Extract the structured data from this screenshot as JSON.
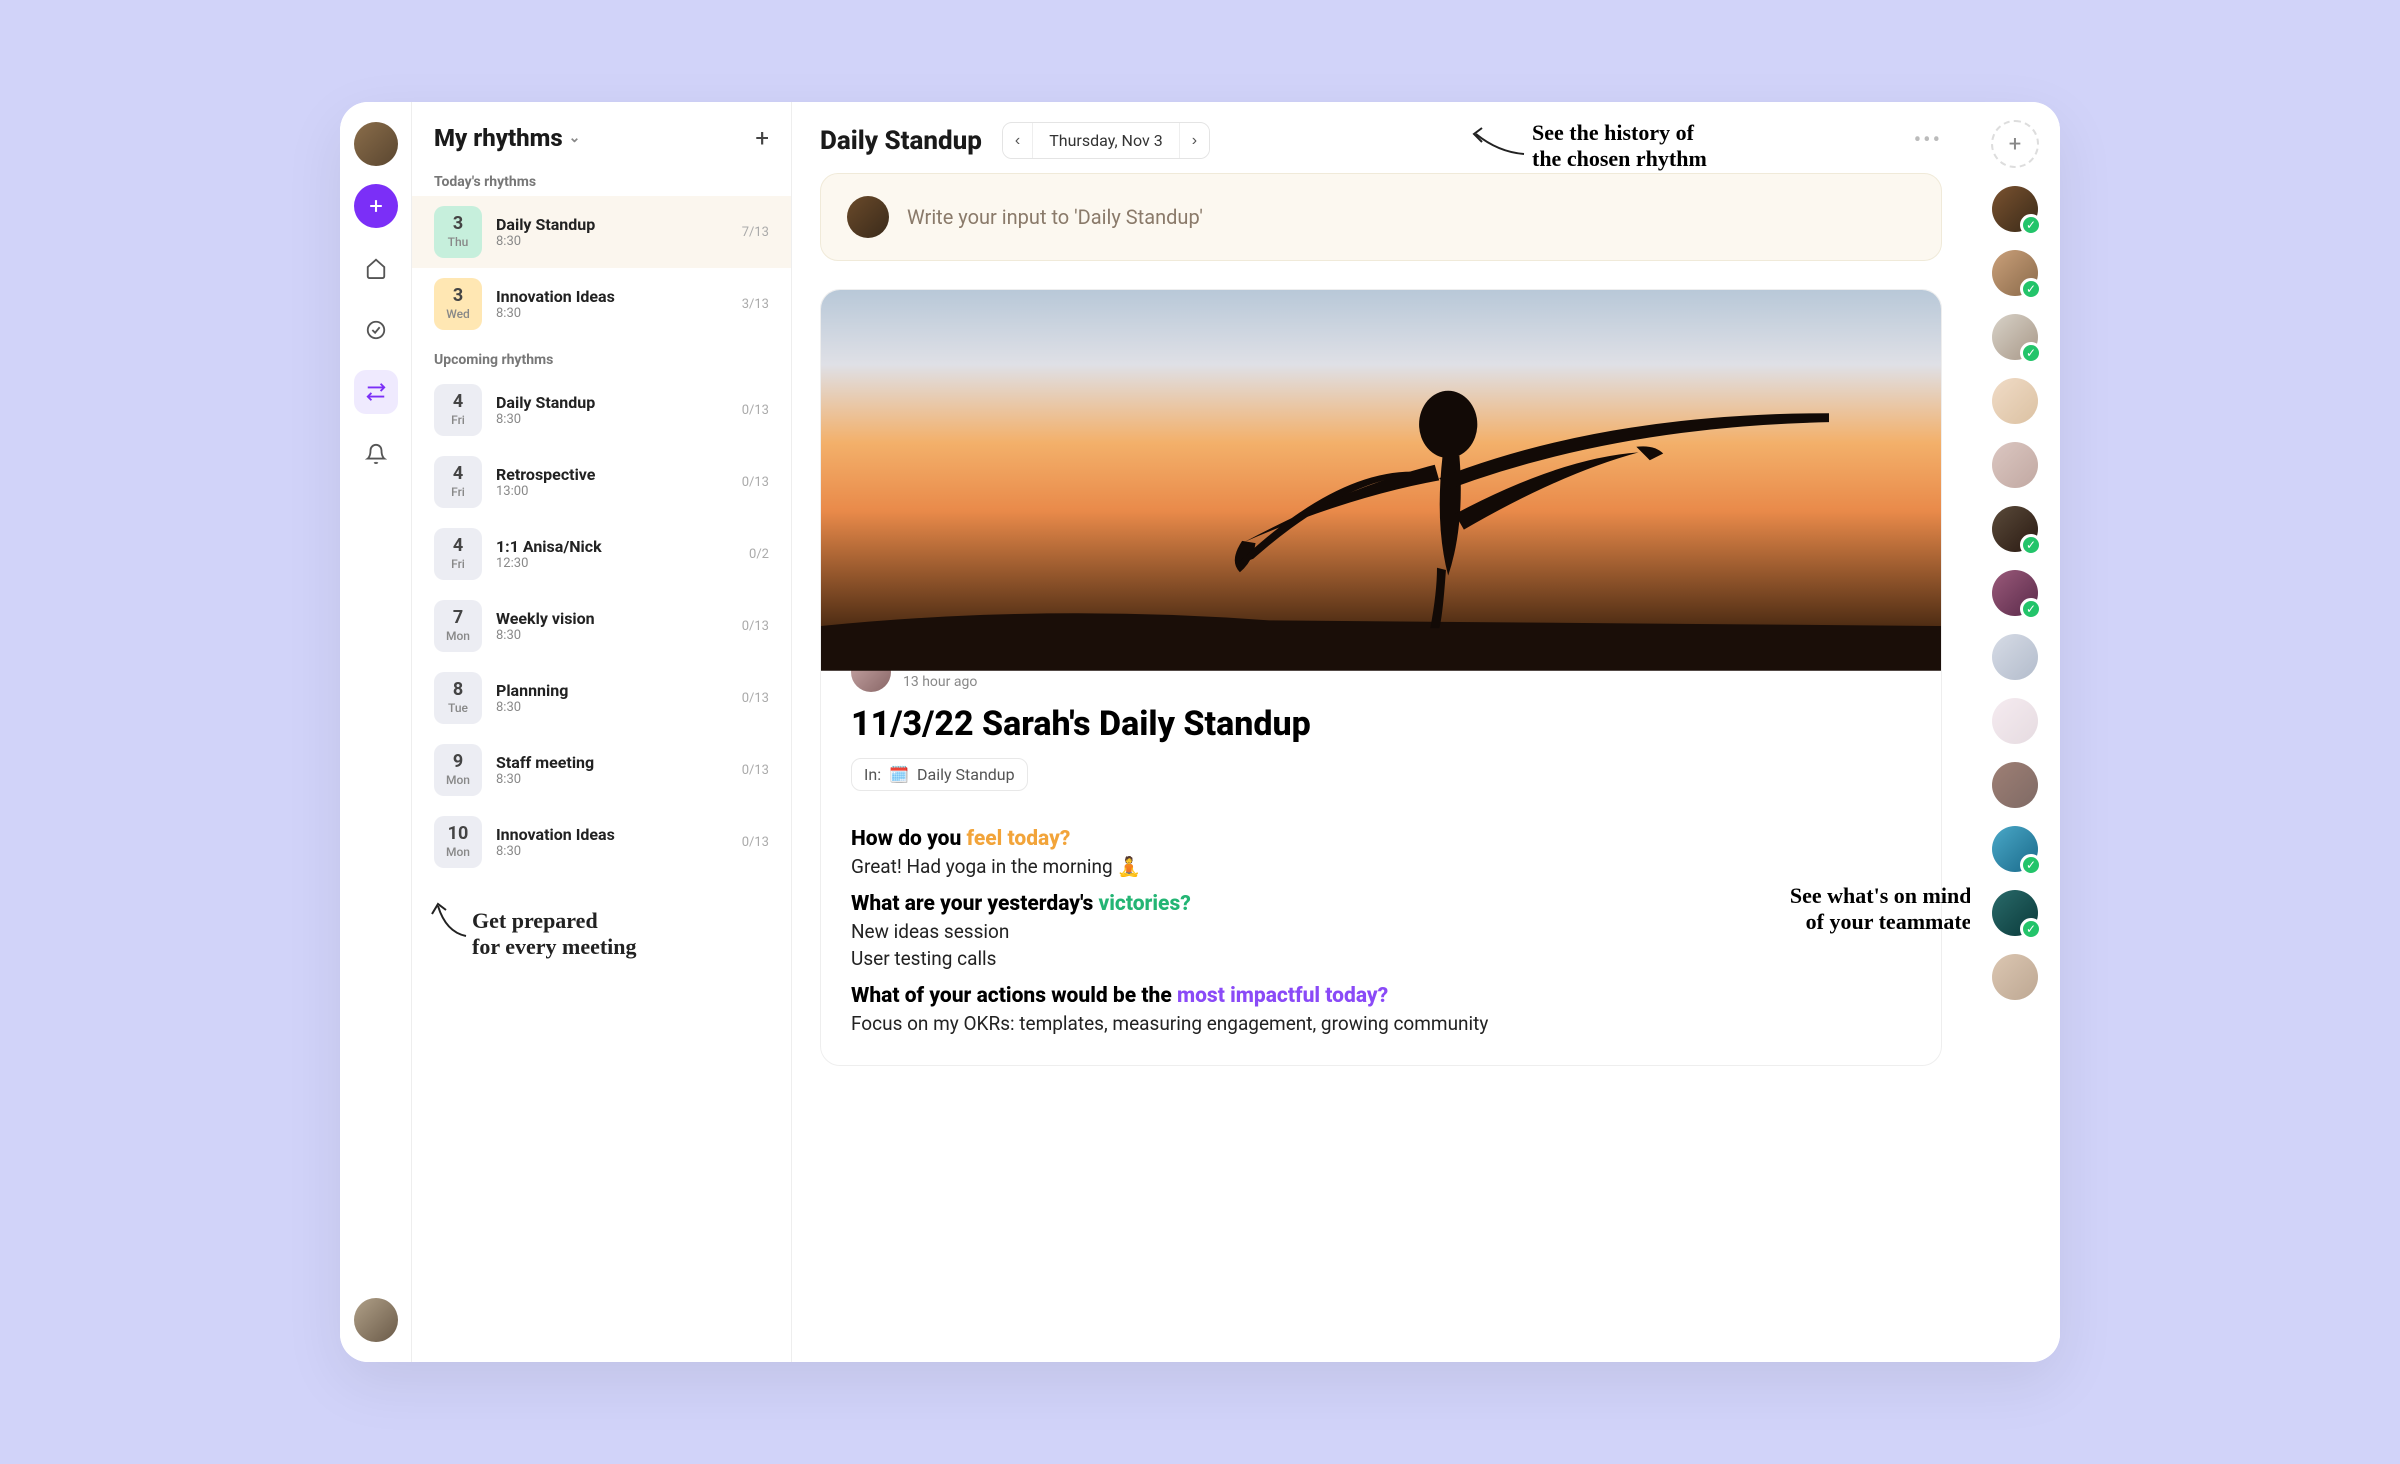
{
  "sidebar": {
    "title": "My rhythms",
    "sections": {
      "today_label": "Today's rhythms",
      "upcoming_label": "Upcoming rhythms"
    },
    "today": [
      {
        "dnum": "3",
        "dow": "Thu",
        "title": "Daily Standup",
        "time": "8:30",
        "count": "7/13",
        "chip": "green",
        "active": true
      },
      {
        "dnum": "3",
        "dow": "Wed",
        "title": "Innovation Ideas",
        "time": "8:30",
        "count": "3/13",
        "chip": "yellow"
      }
    ],
    "upcoming": [
      {
        "dnum": "4",
        "dow": "Fri",
        "title": "Daily Standup",
        "time": "8:30",
        "count": "0/13"
      },
      {
        "dnum": "4",
        "dow": "Fri",
        "title": "Retrospective",
        "time": "13:00",
        "count": "0/13"
      },
      {
        "dnum": "4",
        "dow": "Fri",
        "title": "1:1  Anisa/Nick",
        "time": "12:30",
        "count": "0/2"
      },
      {
        "dnum": "7",
        "dow": "Mon",
        "title": "Weekly vision",
        "time": "8:30",
        "count": "0/13"
      },
      {
        "dnum": "8",
        "dow": "Tue",
        "title": "Plannning",
        "time": "8:30",
        "count": "0/13"
      },
      {
        "dnum": "9",
        "dow": "Mon",
        "title": "Staff meeting",
        "time": "8:30",
        "count": "0/13"
      },
      {
        "dnum": "10",
        "dow": "Mon",
        "title": "Innovation Ideas",
        "time": "8:30",
        "count": "0/13"
      }
    ]
  },
  "main": {
    "title": "Daily Standup",
    "date": "Thursday, Nov 3",
    "input_placeholder": "Write your input to 'Daily Standup'",
    "post": {
      "author": "Sarah",
      "timestamp": "13 hour ago",
      "heading": "11/3/22 Sarah's Daily Standup",
      "in_label": "In:",
      "in_target": "Daily Standup",
      "q1_a": "How do you ",
      "q1_b": "feel today?",
      "a1": "Great! Had yoga in the morning 🧘",
      "q2_a": "What are your yesterday's ",
      "q2_b": "victories?",
      "a2a": "New ideas session",
      "a2b": "User testing calls",
      "q3_a": "What of your actions would be the ",
      "q3_b": "most impactful today?",
      "a3": "Focus on my OKRs: templates, measuring engagement, growing community"
    }
  },
  "annotations": {
    "history": "See the history of\nthe chosen rhythm",
    "teammates": "See what's on minds\nof your teammates",
    "prepared": "Get prepared\nfor every meeting"
  },
  "team": [
    {
      "checked": true,
      "bg": "linear-gradient(135deg,#7a5230,#3a2a18)"
    },
    {
      "checked": true,
      "bg": "linear-gradient(135deg,#caa07a,#8a6a4a)"
    },
    {
      "checked": true,
      "bg": "linear-gradient(135deg,#d8d2c8,#a89888)"
    },
    {
      "checked": false,
      "bg": "linear-gradient(135deg,#e8c8a8,#c8a070)",
      "faded": true
    },
    {
      "checked": false,
      "bg": "linear-gradient(135deg,#c8a8a0,#a07a70)",
      "faded": true
    },
    {
      "checked": true,
      "bg": "linear-gradient(135deg,#5a4a3a,#2a1a12)"
    },
    {
      "checked": true,
      "bg": "linear-gradient(135deg,#9a5a7a,#5a2a4a)"
    },
    {
      "checked": false,
      "bg": "linear-gradient(135deg,#c0c8d8,#8a98b0)",
      "faded": true
    },
    {
      "checked": false,
      "bg": "linear-gradient(135deg,#f0e0e8,#d8c8d0)",
      "faded": true
    },
    {
      "checked": false,
      "bg": "linear-gradient(135deg,#6a3a2a,#3a1a12)",
      "faded": true
    },
    {
      "checked": true,
      "bg": "linear-gradient(135deg,#4aa8c8,#1a6a8a)"
    },
    {
      "checked": true,
      "bg": "linear-gradient(135deg,#2a6a6a,#0a3a3a)"
    },
    {
      "checked": false,
      "bg": "linear-gradient(135deg,#c8a888,#9a7858)",
      "faded": true
    }
  ]
}
